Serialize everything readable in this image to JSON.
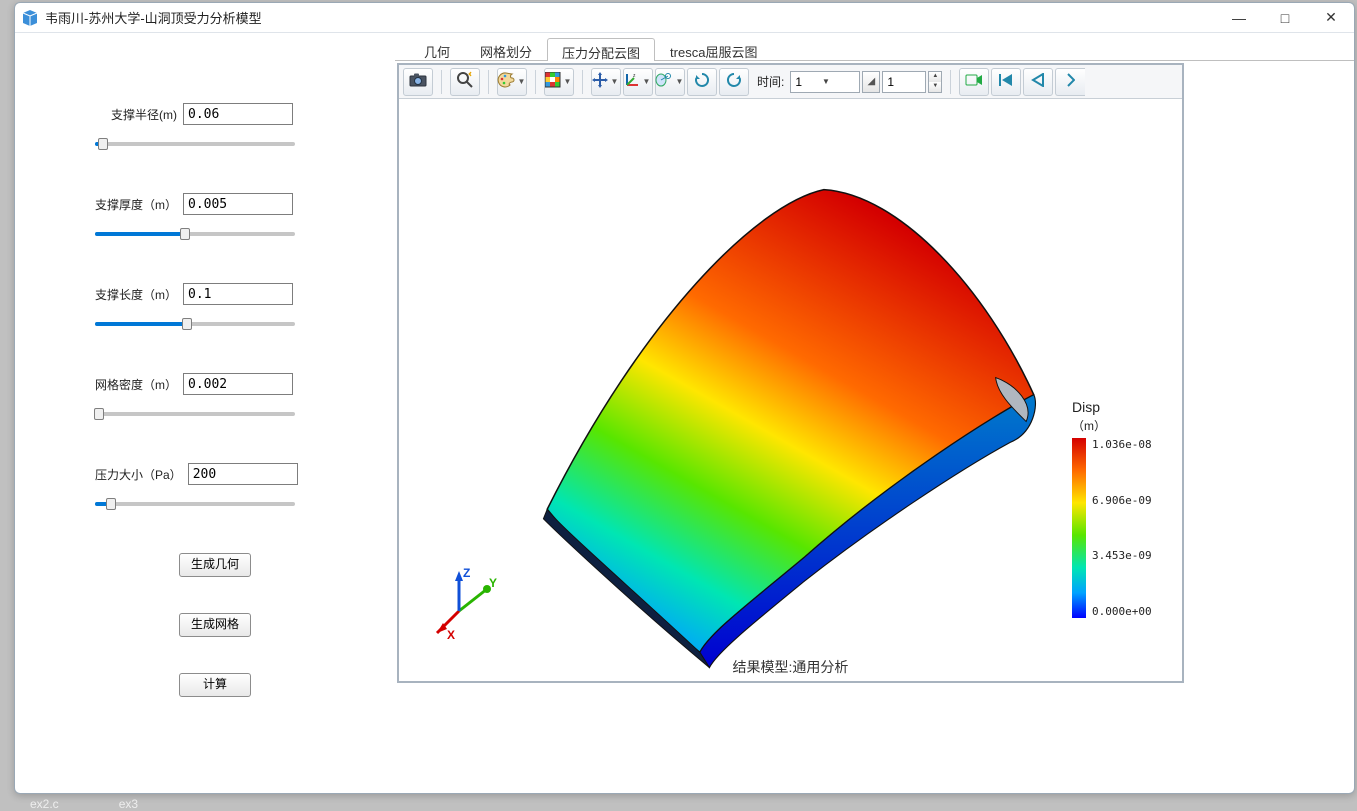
{
  "window": {
    "title": "韦雨川-苏州大学-山洞顶受力分析模型"
  },
  "system_buttons": {
    "minimize": "—",
    "maximize": "□",
    "close": "✕"
  },
  "params": {
    "radius": {
      "label": "支撑半径(m)",
      "value": "0.06",
      "fill_pct": 4
    },
    "thickness": {
      "label": "支撑厚度（m）",
      "value": "0.005",
      "fill_pct": 45
    },
    "length": {
      "label": "支撑长度（m）",
      "value": "0.1",
      "fill_pct": 46
    },
    "mesh": {
      "label": "网格密度（m）",
      "value": "0.002",
      "fill_pct": 2
    },
    "pressure": {
      "label": "压力大小（Pa）",
      "value": "200",
      "fill_pct": 8
    }
  },
  "buttons": {
    "geom": "生成几何",
    "mesh": "生成网格",
    "solve": "计算"
  },
  "tabs": {
    "geom": "几何",
    "mesh": "网格划分",
    "pressure": "压力分配云图",
    "tresca": "tresca屈服云图"
  },
  "toolbar": {
    "time_label": "时间:",
    "time_value": "1",
    "frame_value": "1"
  },
  "legend": {
    "title": "Disp",
    "unit": "（m）",
    "ticks": [
      "1.036e-08",
      "6.906e-09",
      "3.453e-09",
      "0.000e+00"
    ]
  },
  "caption": "结果模型:通用分析",
  "triad": {
    "x": "X",
    "y": "Y",
    "z": "Z"
  },
  "taskbar": {
    "a": "ex2.c",
    "b": "ex3"
  }
}
